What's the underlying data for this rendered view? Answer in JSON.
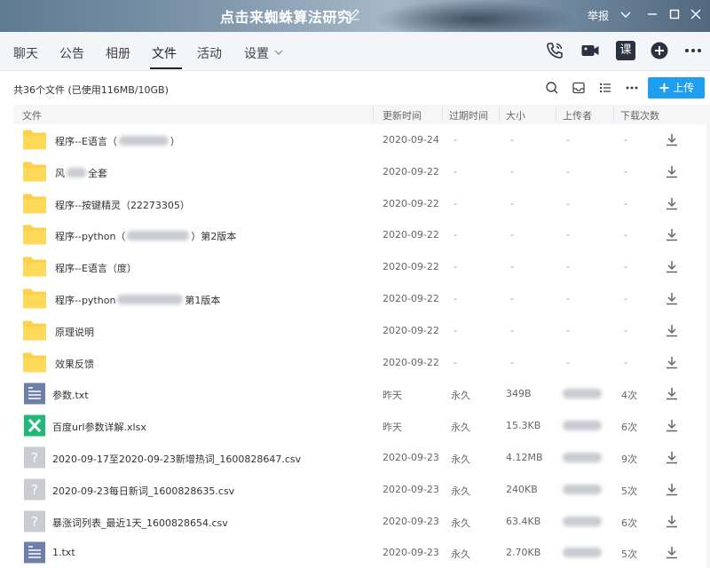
{
  "window": {
    "title": "点击来蜘蛛算法研究",
    "report": "举报"
  },
  "tabs": [
    {
      "label": "聊天"
    },
    {
      "label": "公告"
    },
    {
      "label": "相册"
    },
    {
      "label": "文件",
      "active": true
    },
    {
      "label": "活动"
    },
    {
      "label": "设置"
    }
  ],
  "tab_icons": [
    "phone-icon",
    "video-icon",
    "course-icon",
    "add-icon",
    "more-icon"
  ],
  "course_label": "课",
  "toolbar": {
    "summary": "共36个文件 (已使用116MB/10GB)",
    "upload_label": "上传"
  },
  "columns": {
    "name": "文件",
    "updated": "更新时间",
    "expires": "过期时间",
    "size": "大小",
    "uploader": "上传者",
    "downloads": "下载次数"
  },
  "accent": "#1f9ef0",
  "rows": [
    {
      "type": "folder",
      "name_a": "程序--E语言（",
      "name_b": "）",
      "date": "2020-09-24",
      "expires": "-",
      "size": "-",
      "uploader": "-",
      "count": "-"
    },
    {
      "type": "folder",
      "name_a": "风",
      "name_b": "全套",
      "date": "2020-09-22",
      "expires": "-",
      "size": "-",
      "uploader": "-",
      "count": "-"
    },
    {
      "type": "folder",
      "name_a": "程序--按键精灵（22273305）",
      "name_b": "",
      "date": "2020-09-22",
      "expires": "-",
      "size": "-",
      "uploader": "-",
      "count": "-"
    },
    {
      "type": "folder",
      "name_a": "程序--python（",
      "name_b": "）第2版本",
      "date": "2020-09-22",
      "expires": "-",
      "size": "-",
      "uploader": "-",
      "count": "-"
    },
    {
      "type": "folder",
      "name_a": "程序--E语言（度）",
      "name_b": "",
      "date": "2020-09-22",
      "expires": "-",
      "size": "-",
      "uploader": "-",
      "count": "-"
    },
    {
      "type": "folder",
      "name_a": "程序--python",
      "name_b": "第1版本",
      "date": "2020-09-22",
      "expires": "-",
      "size": "-",
      "uploader": "-",
      "count": "-"
    },
    {
      "type": "folder",
      "name_a": "原理说明",
      "name_b": "",
      "date": "2020-09-22",
      "expires": "-",
      "size": "-",
      "uploader": "-",
      "count": "-"
    },
    {
      "type": "folder",
      "name_a": "效果反馈",
      "name_b": "",
      "date": "2020-09-22",
      "expires": "-",
      "size": "-",
      "uploader": "-",
      "count": "-"
    },
    {
      "type": "txt",
      "name_a": "参数.txt",
      "name_b": "",
      "date": "昨天",
      "expires": "永久",
      "size": "349B",
      "uploader": "",
      "count": "4次"
    },
    {
      "type": "xlsx",
      "name_a": "百度url参数详解.xlsx",
      "name_b": "",
      "date": "昨天",
      "expires": "永久",
      "size": "15.3KB",
      "uploader": "",
      "count": "6次"
    },
    {
      "type": "unknown",
      "name_a": "2020-09-17至2020-09-23新增热词_1600828647.csv",
      "name_b": "",
      "date": "2020-09-23",
      "expires": "永久",
      "size": "4.12MB",
      "uploader": "",
      "count": "9次"
    },
    {
      "type": "unknown",
      "name_a": "2020-09-23每日新词_1600828635.csv",
      "name_b": "",
      "date": "2020-09-23",
      "expires": "永久",
      "size": "240KB",
      "uploader": "",
      "count": "5次"
    },
    {
      "type": "unknown",
      "name_a": "暴涨词列表_最近1天_1600828654.csv",
      "name_b": "",
      "date": "2020-09-23",
      "expires": "永久",
      "size": "63.4KB",
      "uploader": "",
      "count": "6次"
    },
    {
      "type": "txt",
      "name_a": "1.txt",
      "name_b": "",
      "date": "2020-09-23",
      "expires": "永久",
      "size": "2.70KB",
      "uploader": "",
      "count": "5次"
    }
  ]
}
